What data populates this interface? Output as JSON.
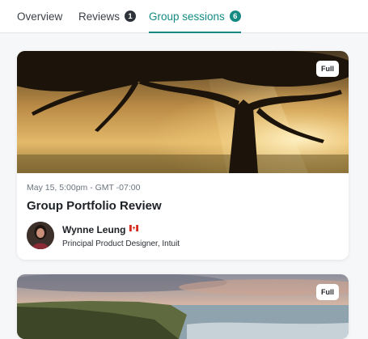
{
  "tabs": [
    {
      "label": "Overview"
    },
    {
      "label": "Reviews",
      "count": "1"
    },
    {
      "label": "Group sessions",
      "count": "6",
      "active": true
    }
  ],
  "sessions": [
    {
      "status": "Full",
      "datetime": "May 15, 5:00pm - GMT -07:00",
      "title": "Group Portfolio Review",
      "host": {
        "name": "Wynne Leung",
        "flag_icon": "canada-flag-icon",
        "role": "Principal Product Designer, Intuit"
      },
      "image_icon": "tree-sunset-photo"
    },
    {
      "status": "Full",
      "image_icon": "coastal-cliffs-photo"
    }
  ],
  "colors": {
    "accent": "#148a82",
    "badge_dark": "#2f343b",
    "muted_text": "#6b7480"
  }
}
